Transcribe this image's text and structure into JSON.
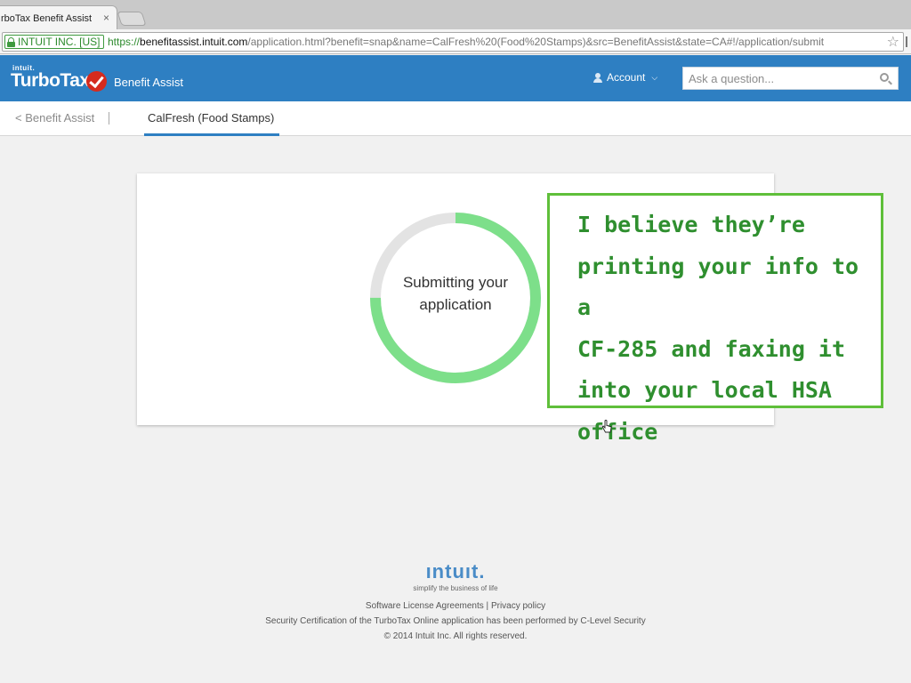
{
  "browser": {
    "tab_title": "rboTax Benefit Assist",
    "tab_close": "×",
    "ev_label": "INTUIT INC. [US]",
    "url_scheme": "https://",
    "url_host": "benefitassist.intuit.com",
    "url_rest": "/application.html?benefit=snap&name=CalFresh%20(Food%20Stamps)&src=BenefitAssist&state=CA#!/application/submit",
    "bookmark_star": "☆"
  },
  "header": {
    "brand_small": "intuit.",
    "brand": "TurboTax",
    "product": "Benefit Assist",
    "account_label": "Account",
    "account_chevron": "⌵",
    "search_placeholder": "Ask a question..."
  },
  "subnav": {
    "back_label": "< Benefit Assist",
    "active_tab": "CalFresh (Food Stamps)"
  },
  "card": {
    "status_line1": "Submitting your",
    "status_line2": "application",
    "progress": 0.75,
    "progress_color": "#7ddf8a",
    "track_color": "#e3e3e3"
  },
  "note": {
    "lines": [
      "I believe they’re",
      "printing your info to a",
      "CF-285 and faxing it",
      "into your local HSA",
      "office"
    ],
    "border_color": "#5fbf3a",
    "text_color": "#2f8f2f"
  },
  "footer": {
    "logo": "ıntuıt.",
    "tagline": "simplify the business of life",
    "license_link": "Software License Agreements",
    "separator": " | ",
    "privacy_link": "Privacy policy",
    "security_line": "Security Certification of the TurboTax Online application has been performed by C-Level Security",
    "copyright": "© 2014 Intuit Inc. All rights reserved."
  },
  "colors": {
    "header_blue": "#2e7fc2",
    "turbotax_check_red": "#d52b1e"
  }
}
